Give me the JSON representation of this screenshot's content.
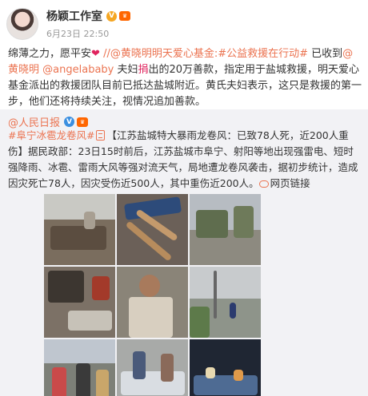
{
  "header": {
    "name": "杨颖工作室",
    "verified_icon": "verified-badge-icon",
    "vip_icon": "vip-badge-icon",
    "time": "6月23日 22:50"
  },
  "post": {
    "line1_pre": "绵薄之力，愿平安",
    "line1_link": "//@黄晓明明天爱心基金:#公益救援在行动#",
    "line1_post": " 已收到",
    "mention1": "@黄晓明",
    "mention2": "@angelababy",
    "line2_pre": " 夫妇",
    "line2_red": "捐",
    "line2_post": "出的20万善款，指定用于盐城救援，明天爱心基金派出的救援团队目前已抵达盐城附近。黄氏夫妇表示，这只是救援的第一步，他们还将持续关注，视情况追加善款。"
  },
  "repost": {
    "author": "@人民日报",
    "tag": "#阜宁冰雹龙卷风#",
    "headline": "【江苏盐城特大暴雨龙卷风：已致78人死，近200人重伤】",
    "body": "据民政部：23日15时前后，江苏盐城市阜宁、射阳等地出现强雷电、短时强降雨、冰雹、雷雨大风等强对流天气，局地遭龙卷风袭击，据初步统计，造成因灾死亡78人，因灾受伤近500人，其中重伤近200人。",
    "web_link": "网页链接"
  },
  "photos": [
    {
      "name": "photo-debris-field"
    },
    {
      "name": "photo-collapsed-roof"
    },
    {
      "name": "photo-damaged-trees"
    },
    {
      "name": "photo-destroyed-room"
    },
    {
      "name": "photo-injured-man"
    },
    {
      "name": "photo-road-poles"
    },
    {
      "name": "photo-street-crowd"
    },
    {
      "name": "photo-hospital-ward"
    },
    {
      "name": "photo-rescue-night"
    }
  ],
  "colors": {
    "accent": "#eb7350",
    "quote_bg": "#f2f2f5"
  }
}
